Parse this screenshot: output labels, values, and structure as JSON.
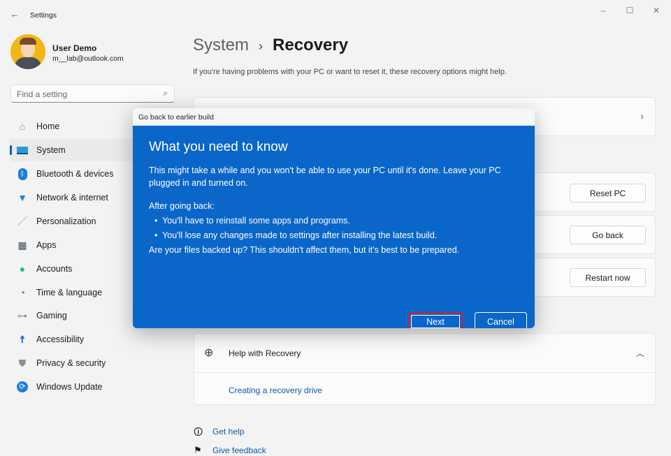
{
  "window": {
    "title": "Settings"
  },
  "user": {
    "name": "User Demo",
    "email": "m__lab@outlook.com"
  },
  "search": {
    "placeholder": "Find a setting"
  },
  "sidebar": {
    "items": [
      {
        "label": "Home",
        "icon": "home-icon"
      },
      {
        "label": "System",
        "icon": "system-icon",
        "selected": true
      },
      {
        "label": "Bluetooth & devices",
        "icon": "bluetooth-icon"
      },
      {
        "label": "Network & internet",
        "icon": "wifi-icon"
      },
      {
        "label": "Personalization",
        "icon": "brush-icon"
      },
      {
        "label": "Apps",
        "icon": "apps-icon"
      },
      {
        "label": "Accounts",
        "icon": "accounts-icon"
      },
      {
        "label": "Time & language",
        "icon": "time-language-icon"
      },
      {
        "label": "Gaming",
        "icon": "gamepad-icon"
      },
      {
        "label": "Accessibility",
        "icon": "accessibility-icon"
      },
      {
        "label": "Privacy & security",
        "icon": "shield-icon"
      },
      {
        "label": "Windows Update",
        "icon": "update-icon"
      }
    ]
  },
  "header": {
    "parent": "System",
    "separator": "›",
    "current": "Recovery",
    "subtitle": "If you're having problems with your PC or want to reset it, these recovery options might help."
  },
  "options": {
    "reset": "Reset PC",
    "go_back": "Go back",
    "restart": "Restart now"
  },
  "help": {
    "title": "Help with Recovery",
    "link": "Creating a recovery drive"
  },
  "footer": {
    "get_help": "Get help",
    "feedback": "Give feedback"
  },
  "dialog": {
    "title": "Go back to earlier build",
    "heading": "What you need to know",
    "intro": "This might take a while and you won't be able to use your PC until it's done. Leave your PC plugged in and turned on.",
    "after": "After going back:",
    "bullets": [
      "You'll have to reinstall some apps and programs.",
      "You'll lose any changes made to settings after installing the latest build."
    ],
    "question": "Are your files backed up? This shouldn't affect them, but it's best to be prepared.",
    "next": "Next",
    "cancel": "Cancel"
  },
  "colors": {
    "dialog_bg": "#0a66c9",
    "accent": "#005fb8",
    "highlight": "#d0202e"
  }
}
